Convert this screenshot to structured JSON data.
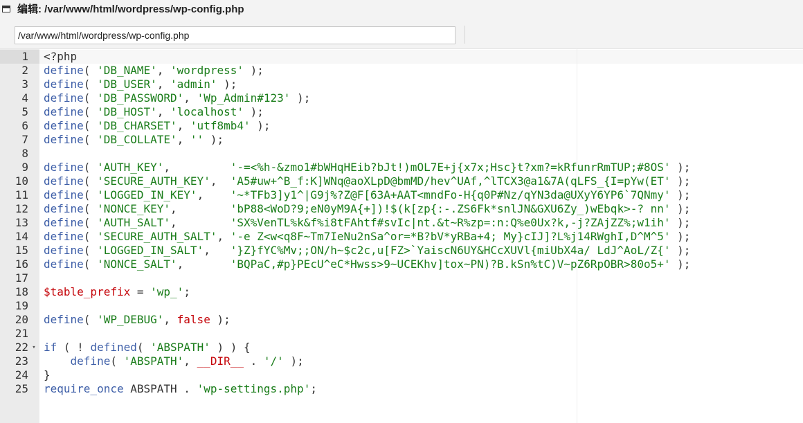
{
  "title": "编辑: /var/www/html/wordpress/wp-config.php",
  "path_value": "/var/www/html/wordpress/wp-config.php",
  "editor": {
    "lines": [
      {
        "num": "1",
        "tokens": [
          {
            "t": "<?php",
            "c": "p"
          }
        ]
      },
      {
        "num": "2",
        "tokens": [
          {
            "t": "define",
            "c": "k"
          },
          {
            "t": "( ",
            "c": "p"
          },
          {
            "t": "'DB_NAME'",
            "c": "s"
          },
          {
            "t": ", ",
            "c": "p"
          },
          {
            "t": "'wordpress'",
            "c": "s"
          },
          {
            "t": " );",
            "c": "p"
          }
        ]
      },
      {
        "num": "3",
        "tokens": [
          {
            "t": "define",
            "c": "k"
          },
          {
            "t": "( ",
            "c": "p"
          },
          {
            "t": "'DB_USER'",
            "c": "s"
          },
          {
            "t": ", ",
            "c": "p"
          },
          {
            "t": "'admin'",
            "c": "s"
          },
          {
            "t": " );",
            "c": "p"
          }
        ]
      },
      {
        "num": "4",
        "tokens": [
          {
            "t": "define",
            "c": "k"
          },
          {
            "t": "( ",
            "c": "p"
          },
          {
            "t": "'DB_PASSWORD'",
            "c": "s"
          },
          {
            "t": ", ",
            "c": "p"
          },
          {
            "t": "'Wp_Admin#123'",
            "c": "s"
          },
          {
            "t": " );",
            "c": "p"
          }
        ]
      },
      {
        "num": "5",
        "tokens": [
          {
            "t": "define",
            "c": "k"
          },
          {
            "t": "( ",
            "c": "p"
          },
          {
            "t": "'DB_HOST'",
            "c": "s"
          },
          {
            "t": ", ",
            "c": "p"
          },
          {
            "t": "'localhost'",
            "c": "s"
          },
          {
            "t": " );",
            "c": "p"
          }
        ]
      },
      {
        "num": "6",
        "tokens": [
          {
            "t": "define",
            "c": "k"
          },
          {
            "t": "( ",
            "c": "p"
          },
          {
            "t": "'DB_CHARSET'",
            "c": "s"
          },
          {
            "t": ", ",
            "c": "p"
          },
          {
            "t": "'utf8mb4'",
            "c": "s"
          },
          {
            "t": " );",
            "c": "p"
          }
        ]
      },
      {
        "num": "7",
        "tokens": [
          {
            "t": "define",
            "c": "k"
          },
          {
            "t": "( ",
            "c": "p"
          },
          {
            "t": "'DB_COLLATE'",
            "c": "s"
          },
          {
            "t": ", ",
            "c": "p"
          },
          {
            "t": "''",
            "c": "s"
          },
          {
            "t": " );",
            "c": "p"
          }
        ]
      },
      {
        "num": "8",
        "tokens": []
      },
      {
        "num": "9",
        "tokens": [
          {
            "t": "define",
            "c": "k"
          },
          {
            "t": "( ",
            "c": "p"
          },
          {
            "t": "'AUTH_KEY'",
            "c": "s"
          },
          {
            "t": ",         ",
            "c": "p"
          },
          {
            "t": "'-=<%h-&zmo1#bWHqHEib?bJt!)mOL7E+j{x7x;Hsc}t?xm?=kRfunrRmTUP;#8OS'",
            "c": "s"
          },
          {
            "t": " );",
            "c": "p"
          }
        ]
      },
      {
        "num": "10",
        "tokens": [
          {
            "t": "define",
            "c": "k"
          },
          {
            "t": "( ",
            "c": "p"
          },
          {
            "t": "'SECURE_AUTH_KEY'",
            "c": "s"
          },
          {
            "t": ",  ",
            "c": "p"
          },
          {
            "t": "'A5#uw+^B_f:K]WNq@aoXLpD@bmMD/hev^UAf,^lTCX3@a1&7A(qLFS_{I=pYw(ET'",
            "c": "s"
          },
          {
            "t": " );",
            "c": "p"
          }
        ]
      },
      {
        "num": "11",
        "tokens": [
          {
            "t": "define",
            "c": "k"
          },
          {
            "t": "( ",
            "c": "p"
          },
          {
            "t": "'LOGGED_IN_KEY'",
            "c": "s"
          },
          {
            "t": ",    ",
            "c": "p"
          },
          {
            "t": "'~*TFb3]y1^|G9j%?Z@F[63A+AAT<mndFo-H{q0P#Nz/qYN3da@UXyY6YP6`7QNmy'",
            "c": "s"
          },
          {
            "t": " );",
            "c": "p"
          }
        ]
      },
      {
        "num": "12",
        "tokens": [
          {
            "t": "define",
            "c": "k"
          },
          {
            "t": "( ",
            "c": "p"
          },
          {
            "t": "'NONCE_KEY'",
            "c": "s"
          },
          {
            "t": ",        ",
            "c": "p"
          },
          {
            "t": "'bP88<WoD?9;eN0yM9A{+])!$(k[zp{:-.ZS6Fk*snlJN&GXU6Zy_)wEbqk>-? nn'",
            "c": "s"
          },
          {
            "t": " );",
            "c": "p"
          }
        ]
      },
      {
        "num": "13",
        "tokens": [
          {
            "t": "define",
            "c": "k"
          },
          {
            "t": "( ",
            "c": "p"
          },
          {
            "t": "'AUTH_SALT'",
            "c": "s"
          },
          {
            "t": ",        ",
            "c": "p"
          },
          {
            "t": "'SX%VenTL%k&f%i8tFAhtf#svIc|nt.&t~R%zp=:n:Q%e0Ux?k,-j?ZAjZZ%;w1ih'",
            "c": "s"
          },
          {
            "t": " );",
            "c": "p"
          }
        ]
      },
      {
        "num": "14",
        "tokens": [
          {
            "t": "define",
            "c": "k"
          },
          {
            "t": "( ",
            "c": "p"
          },
          {
            "t": "'SECURE_AUTH_SALT'",
            "c": "s"
          },
          {
            "t": ", ",
            "c": "p"
          },
          {
            "t": "'-e Z<w<q8F~Tm7IeNu2nSa^or=*B?bV*yRBa+4; My}cIJ]?L%j14RWghI,D^M^5'",
            "c": "s"
          },
          {
            "t": " );",
            "c": "p"
          }
        ]
      },
      {
        "num": "15",
        "tokens": [
          {
            "t": "define",
            "c": "k"
          },
          {
            "t": "( ",
            "c": "p"
          },
          {
            "t": "'LOGGED_IN_SALT'",
            "c": "s"
          },
          {
            "t": ",   ",
            "c": "p"
          },
          {
            "t": "'}Z}fYC%Mv;;ON/h~$c2c,u[FZ>`YaiscN6UY&HCcXUVl{miUbX4a/ LdJ^AoL/Z{'",
            "c": "s"
          },
          {
            "t": " );",
            "c": "p"
          }
        ]
      },
      {
        "num": "16",
        "tokens": [
          {
            "t": "define",
            "c": "k"
          },
          {
            "t": "( ",
            "c": "p"
          },
          {
            "t": "'NONCE_SALT'",
            "c": "s"
          },
          {
            "t": ",       ",
            "c": "p"
          },
          {
            "t": "'BQPaC,#p}PEcU^eC*Hwss>9~UCEKhv]tox~PN)?B.kSn%tC)V~pZ6RpOBR>80o5+'",
            "c": "s"
          },
          {
            "t": " );",
            "c": "p"
          }
        ]
      },
      {
        "num": "17",
        "tokens": []
      },
      {
        "num": "18",
        "tokens": [
          {
            "t": "$table_prefix",
            "c": "v"
          },
          {
            "t": " = ",
            "c": "p"
          },
          {
            "t": "'wp_'",
            "c": "s"
          },
          {
            "t": ";",
            "c": "p"
          }
        ]
      },
      {
        "num": "19",
        "tokens": []
      },
      {
        "num": "20",
        "tokens": [
          {
            "t": "define",
            "c": "k"
          },
          {
            "t": "( ",
            "c": "p"
          },
          {
            "t": "'WP_DEBUG'",
            "c": "s"
          },
          {
            "t": ", ",
            "c": "p"
          },
          {
            "t": "false",
            "c": "f"
          },
          {
            "t": " );",
            "c": "p"
          }
        ]
      },
      {
        "num": "21",
        "tokens": []
      },
      {
        "num": "22",
        "fold": true,
        "tokens": [
          {
            "t": "if",
            "c": "k"
          },
          {
            "t": " ( ! ",
            "c": "p"
          },
          {
            "t": "defined",
            "c": "k"
          },
          {
            "t": "( ",
            "c": "p"
          },
          {
            "t": "'ABSPATH'",
            "c": "s"
          },
          {
            "t": " ) ) {",
            "c": "p"
          }
        ]
      },
      {
        "num": "23",
        "tokens": [
          {
            "t": "    ",
            "c": "p"
          },
          {
            "t": "define",
            "c": "k"
          },
          {
            "t": "( ",
            "c": "p"
          },
          {
            "t": "'ABSPATH'",
            "c": "s"
          },
          {
            "t": ", ",
            "c": "p"
          },
          {
            "t": "__DIR__",
            "c": "f"
          },
          {
            "t": " . ",
            "c": "p"
          },
          {
            "t": "'/'",
            "c": "s"
          },
          {
            "t": " );",
            "c": "p"
          }
        ]
      },
      {
        "num": "24",
        "tokens": [
          {
            "t": "}",
            "c": "p"
          }
        ]
      },
      {
        "num": "25",
        "tokens": [
          {
            "t": "require_once",
            "c": "k"
          },
          {
            "t": " ABSPATH . ",
            "c": "p"
          },
          {
            "t": "'wp-settings.php'",
            "c": "s"
          },
          {
            "t": ";",
            "c": "p"
          }
        ]
      }
    ]
  }
}
